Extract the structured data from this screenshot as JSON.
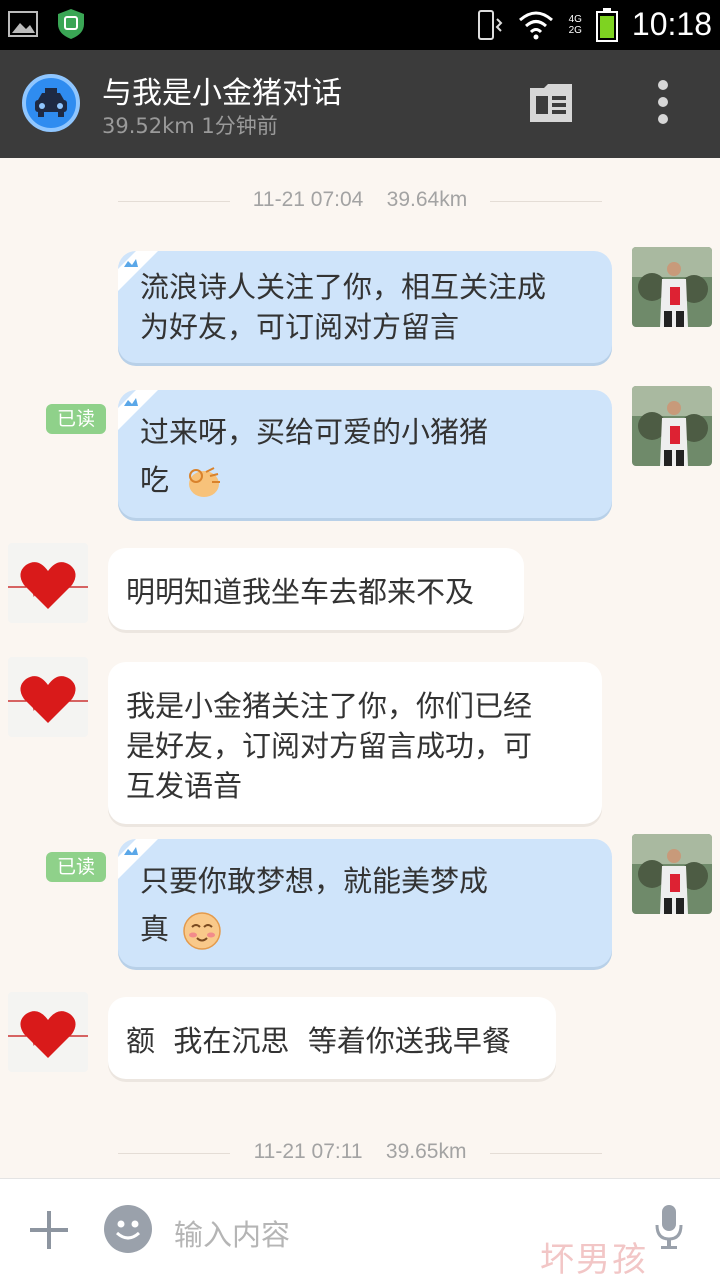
{
  "status_bar": {
    "time": "10:18",
    "network_top": "4G",
    "network_bottom": "2G"
  },
  "header": {
    "title": "与我是小金猪对话",
    "subtitle": "39.52km 1分钟前",
    "icons": [
      "taxi-icon",
      "card-icon",
      "more-icon"
    ]
  },
  "timestamps": [
    {
      "time": "11-21 07:04",
      "distance": "39.64km"
    },
    {
      "time": "11-21 07:11",
      "distance": "39.65km"
    }
  ],
  "messages": [
    {
      "direction": "out",
      "lines": [
        "流浪诗人关注了你，相互关注成",
        "为好友，可订阅对方留言"
      ]
    },
    {
      "direction": "out",
      "read": "已读",
      "lines": [
        "过来呀，买给可爱的小猪猪",
        "吃"
      ],
      "emoji": "ok-hand-emoji"
    },
    {
      "direction": "in",
      "lines": [
        "明明知道我坐车去都来不及"
      ]
    },
    {
      "direction": "in",
      "lines": [
        "我是小金猪关注了你，你们已经",
        "是好友，订阅对方留言成功，可",
        "互发语音"
      ]
    },
    {
      "direction": "out",
      "read": "已读",
      "lines": [
        "只要你敢梦想，就能美梦成",
        "真"
      ],
      "emoji": "blush-emoji"
    },
    {
      "direction": "in",
      "lines": [
        "额  我在沉思  等着你送我早餐"
      ]
    }
  ],
  "input": {
    "placeholder": "输入内容"
  },
  "watermark": "坏男孩",
  "colors": {
    "outgoing_bubble": "#cfe4fa",
    "incoming_bubble": "#ffffff",
    "read_badge": "#8fd18a",
    "header_bg": "#3b3b3b"
  }
}
